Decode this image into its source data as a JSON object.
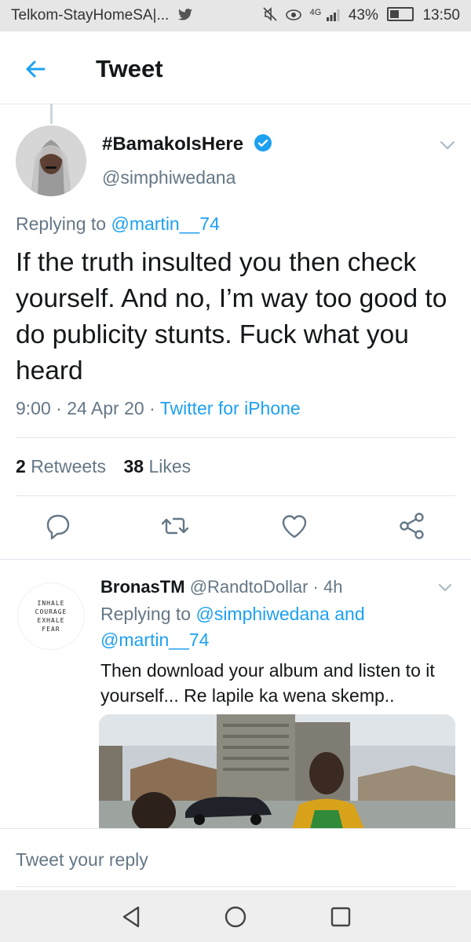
{
  "status_bar": {
    "carrier": "Telkom-StayHomeSA|...",
    "network": "4G",
    "battery": "43%",
    "time": "13:50"
  },
  "header": {
    "title": "Tweet"
  },
  "tweet": {
    "display_name": "#BamakoIsHere",
    "handle": "@simphiwedana",
    "replying_prefix": "Replying to",
    "replying_to": "@martin__74",
    "text": "If the truth insulted you then check yourself. And no, I’m way too good to do publicity stunts. Fuck what you heard",
    "time": "9:00",
    "date": "24 Apr 20",
    "source": "Twitter for iPhone",
    "retweets_count": "2",
    "retweets_label": "Retweets",
    "likes_count": "38",
    "likes_label": "Likes"
  },
  "reply": {
    "avatar_text": [
      "INHALE",
      "COURAGE",
      "EXHALE",
      "FEAR"
    ],
    "display_name": "BronasTM",
    "handle": "@RandtoDollar",
    "time": "4h",
    "replying_prefix": "Replying to",
    "replying_to_1": "@simphiwedana",
    "and_word": "and",
    "replying_to_2": "@martin__74",
    "text": "Then download your album and listen to it yourself... Re lapile ka wena skemp.."
  },
  "reply_bar": {
    "placeholder": "Tweet your reply"
  },
  "colors": {
    "accent": "#1da1f2",
    "secondary_text": "#657786",
    "divider": "#e1e8ed"
  }
}
